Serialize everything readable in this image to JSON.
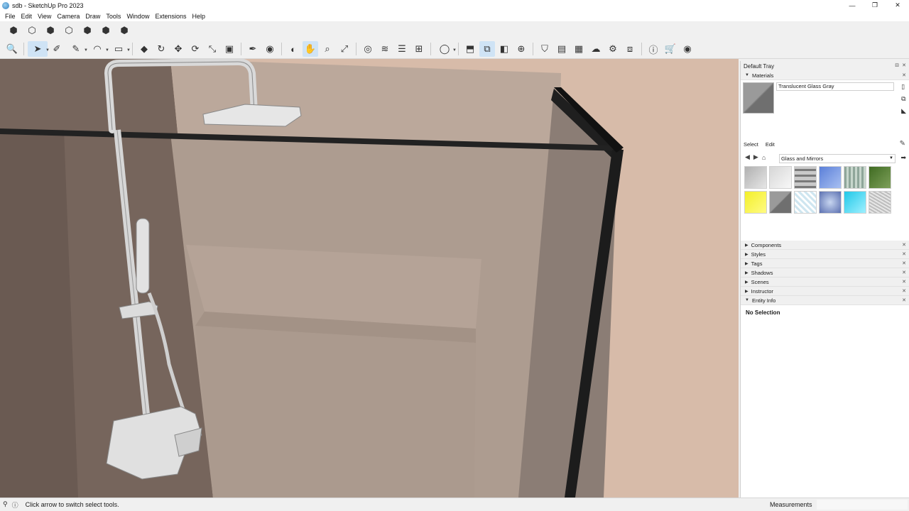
{
  "window": {
    "title": "sdb - SketchUp Pro 2023",
    "controls": [
      "—",
      "❐",
      "✕"
    ]
  },
  "menu": [
    "File",
    "Edit",
    "View",
    "Camera",
    "Draw",
    "Tools",
    "Window",
    "Extensions",
    "Help"
  ],
  "toolbar_views": [
    {
      "name": "iso-view",
      "glyph": "⬢"
    },
    {
      "name": "top-view",
      "glyph": "⬡"
    },
    {
      "name": "front-view",
      "glyph": "⬢"
    },
    {
      "name": "right-view",
      "glyph": "⬡"
    },
    {
      "name": "back-view",
      "glyph": "⬢"
    },
    {
      "name": "left-view",
      "glyph": "⬢"
    },
    {
      "name": "bottom-view",
      "glyph": "⬢"
    }
  ],
  "toolbar_main": [
    {
      "name": "zoom-extents",
      "glyph": "🔍"
    },
    {
      "name": "select-tool",
      "glyph": "➤",
      "active": true,
      "dropdown": true
    },
    {
      "name": "eraser-tool",
      "glyph": "✐"
    },
    {
      "name": "line-tool",
      "glyph": "✎",
      "dropdown": true
    },
    {
      "name": "arc-tool",
      "glyph": "◠",
      "dropdown": true
    },
    {
      "name": "rectangle-tool",
      "glyph": "▭",
      "dropdown": true
    },
    {
      "name": "push-pull-tool",
      "glyph": "◆"
    },
    {
      "name": "follow-me-tool",
      "glyph": "↻"
    },
    {
      "name": "move-tool",
      "glyph": "✥"
    },
    {
      "name": "rotate-tool",
      "glyph": "⟳"
    },
    {
      "name": "scale-tool",
      "glyph": "⤡"
    },
    {
      "name": "offset-tool",
      "glyph": "▣"
    },
    {
      "name": "tape-measure-tool",
      "glyph": "✒"
    },
    {
      "name": "paint-bucket-tool",
      "glyph": "◉"
    },
    {
      "name": "orbit-tool",
      "glyph": "◐"
    },
    {
      "name": "pan-tool",
      "glyph": "✋",
      "active": true
    },
    {
      "name": "zoom-tool",
      "glyph": "⌕"
    },
    {
      "name": "zoom-window-tool",
      "glyph": "⤢"
    },
    {
      "name": "warehouse-tool",
      "glyph": "◎"
    },
    {
      "name": "section-plane-tool",
      "glyph": "≋"
    },
    {
      "name": "layers-tool",
      "glyph": "☰"
    },
    {
      "name": "sandbox-tool",
      "glyph": "⊞"
    },
    {
      "name": "user-menu",
      "glyph": "◯",
      "dropdown": true
    },
    {
      "name": "extension-warehouse",
      "glyph": "⬒"
    },
    {
      "name": "outliner",
      "glyph": "⧉",
      "active": true
    },
    {
      "name": "scenes-tool",
      "glyph": "◧"
    },
    {
      "name": "add-location",
      "glyph": "⊕"
    },
    {
      "name": "solid-tools",
      "glyph": "⛉"
    },
    {
      "name": "styles-tool",
      "glyph": "▤"
    },
    {
      "name": "shadows-tool",
      "glyph": "▦"
    },
    {
      "name": "trimble-connect",
      "glyph": "☁"
    },
    {
      "name": "settings",
      "glyph": "⚙"
    },
    {
      "name": "layout-send",
      "glyph": "⧈"
    },
    {
      "name": "info",
      "glyph": "ⓘ"
    },
    {
      "name": "cart",
      "glyph": "🛒"
    },
    {
      "name": "account",
      "glyph": "◉"
    }
  ],
  "tray": {
    "title": "Default Tray",
    "materials": {
      "header": "Materials",
      "current_material": "Translucent Glass Gray",
      "tabs": [
        "Select",
        "Edit"
      ],
      "collection": "Glass and Mirrors",
      "swatches": [
        {
          "name": "glass-gray-light",
          "color": "linear-gradient(135deg,#b0b0b0,#e6e6e6)"
        },
        {
          "name": "glass-white",
          "color": "linear-gradient(135deg,#d6d6d6,#f8f8f8)"
        },
        {
          "name": "glass-block",
          "color": "repeating-linear-gradient(0deg,#7a7a7a 0 3px,#c9c9c9 3px 8px)"
        },
        {
          "name": "glass-blue",
          "color": "linear-gradient(135deg,#5b7fd8,#a8c0f2)"
        },
        {
          "name": "glass-green-ribbed",
          "color": "repeating-linear-gradient(90deg,#8fa69a 0 3px,#c7d6cc 3px 6px)"
        },
        {
          "name": "glass-green-dark",
          "color": "linear-gradient(135deg,#3f6b22,#7ea05a)"
        },
        {
          "name": "glass-yellow",
          "color": "linear-gradient(135deg,#f3ef2a,#fffb83)"
        },
        {
          "name": "translucent-glass-gray",
          "color": "linear-gradient(135deg,#9a9a9a 48%,#6f6f6f 52%)"
        },
        {
          "name": "glass-pattern-light",
          "color": "repeating-linear-gradient(45deg,#cfe6f0 0 3px,#ffffff 3px 6px)"
        },
        {
          "name": "glass-blue-cloud",
          "color": "radial-gradient(circle,#c7d5f0,#5a6fb0)"
        },
        {
          "name": "glass-cyan",
          "color": "linear-gradient(135deg,#20c8e8,#9ff0ff)"
        },
        {
          "name": "glass-frosted",
          "color": "repeating-linear-gradient(30deg,#bdbdbd 0 2px,#e6e6e6 2px 4px)"
        }
      ]
    },
    "panels": [
      "Components",
      "Styles",
      "Tags",
      "Shadows",
      "Scenes",
      "Instructor"
    ],
    "entity_info": {
      "header": "Entity Info",
      "value": "No Selection"
    }
  },
  "status": {
    "message": "Click arrow to switch select tools.",
    "measurements_label": "Measurements"
  }
}
